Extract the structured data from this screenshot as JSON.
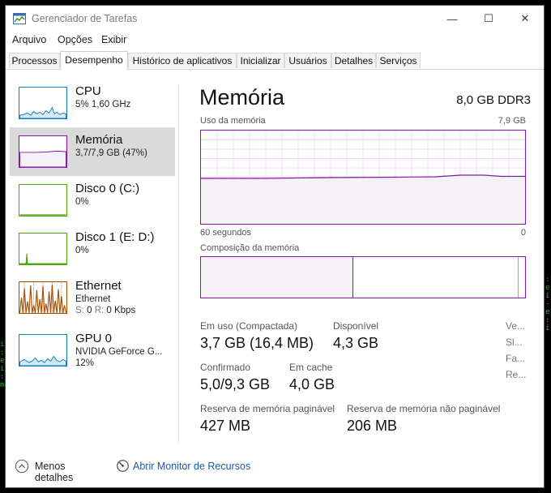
{
  "window": {
    "title": "Gerenciador de Tarefas",
    "controls": {
      "minimize": "—",
      "maximize": "☐",
      "close": "✕"
    }
  },
  "menu": [
    "Arquivo",
    "Opções",
    "Exibir"
  ],
  "tabs": [
    {
      "label": "Processos"
    },
    {
      "label": "Desempenho",
      "active": true
    },
    {
      "label": "Histórico de aplicativos"
    },
    {
      "label": "Inicializar"
    },
    {
      "label": "Usuários"
    },
    {
      "label": "Detalhes"
    },
    {
      "label": "Serviços"
    }
  ],
  "sidebar": [
    {
      "title": "CPU",
      "line1": "5% 1,60 GHz",
      "color": "#117dbb"
    },
    {
      "title": "Memória",
      "line1": "3,7/7,9 GB (47%)",
      "color": "#8b12ae",
      "selected": true
    },
    {
      "title": "Disco 0 (C:)",
      "line1": "0%",
      "color": "#4da60c"
    },
    {
      "title": "Disco 1 (E: D:)",
      "line1": "0%",
      "color": "#4da60c"
    },
    {
      "title": "Ethernet",
      "line1": "Ethernet",
      "send_label": "S:",
      "send_value": "0",
      "recv_label": "R:",
      "recv_value": "0 Kbps",
      "color": "#a74f01"
    },
    {
      "title": "GPU 0",
      "line1": "NVIDIA GeForce G...",
      "line2": "12%",
      "color": "#117dbb"
    }
  ],
  "memory": {
    "title": "Memória",
    "spec": "8,0 GB DDR3",
    "usage_label": "Uso da memória",
    "usage_max": "7,9 GB",
    "time_left": "60 segundos",
    "time_right": "0",
    "composition_label": "Composição da memória",
    "usage_fraction": 0.47,
    "stats": {
      "in_use_label": "Em uso (Compactada)",
      "in_use_value": "3,7 GB (16,4 MB)",
      "available_label": "Disponível",
      "available_value": "4,3 GB",
      "committed_label": "Confirmado",
      "committed_value": "5,0/9,3 GB",
      "cached_label": "Em cache",
      "cached_value": "4,0 GB",
      "paged_label": "Reserva de memória paginável",
      "paged_value": "427 MB",
      "nonpaged_label": "Reserva de memória não paginável",
      "nonpaged_value": "206 MB"
    },
    "side_labels": [
      "Ve...",
      "Sl...",
      "Fa...",
      "Re..."
    ]
  },
  "footer": {
    "fewer_details": "Menos detalhes",
    "resource_monitor": "Abrir Monitor de Recursos"
  }
}
